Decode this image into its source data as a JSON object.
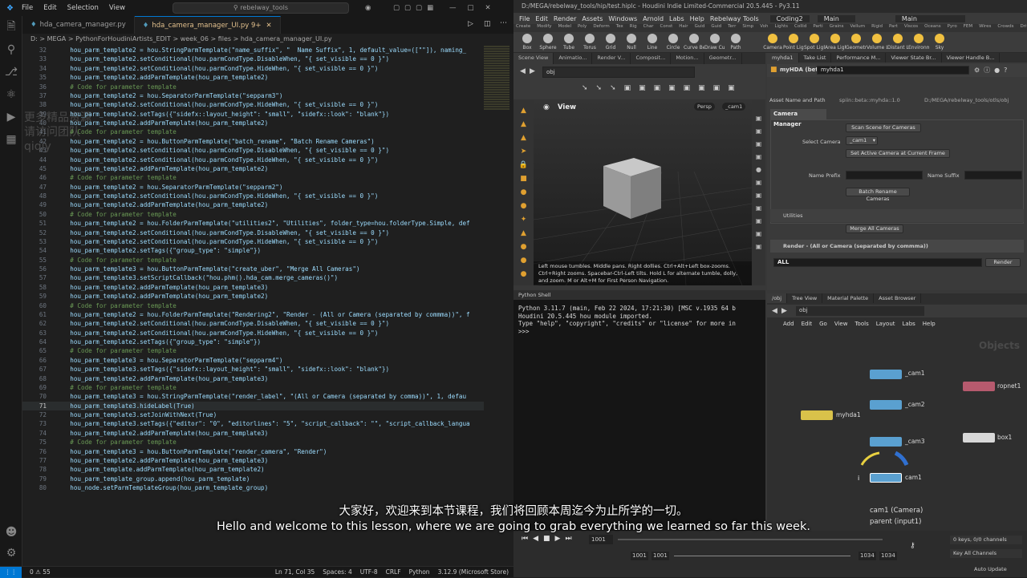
{
  "vscode": {
    "menu": [
      "File",
      "Edit",
      "Selection",
      "View"
    ],
    "search": "rebelway_tools",
    "tabs": [
      {
        "label": "hda_camera_manager.py",
        "active": false
      },
      {
        "label": "hda_camera_manager_UI.py 9+",
        "active": true
      }
    ],
    "breadcrumb": "D: > MEGA > PythonForHoudiniArtists_EDIT > week_06 > files > hda_camera_manager_UI.py",
    "code": [
      {
        "n": "32",
        "t": "    hou_parm_template2 = hou.StringParmTemplate(\"name_suffix\", \"  Name Suffix\", 1, default_value=([\"\"]), naming_"
      },
      {
        "n": "33",
        "t": "    hou_parm_template2.setConditional(hou.parmCondType.DisableWhen, \"{ set_visible == 0 }\")"
      },
      {
        "n": "34",
        "t": "    hou_parm_template2.setConditional(hou.parmCondType.HideWhen, \"{ set_visible == 0 }\")"
      },
      {
        "n": "35",
        "t": "    hou_parm_template2.addParmTemplate(hou_parm_template2)"
      },
      {
        "n": "36",
        "t": "    # Code for parameter template",
        "c": true
      },
      {
        "n": "37",
        "t": "    hou_parm_template2 = hou.SeparatorParmTemplate(\"sepparm3\")"
      },
      {
        "n": "38",
        "t": "    hou_parm_template2.setConditional(hou.parmCondType.HideWhen, \"{ set_visible == 0 }\")"
      },
      {
        "n": "39",
        "t": "    hou_parm_template2.setTags({\"sidefx::layout_height\": \"small\", \"sidefx::look\": \"blank\"})"
      },
      {
        "n": "40",
        "t": "    hou_parm_template2.addParmTemplate(hou_parm_template2)"
      },
      {
        "n": "41",
        "t": "    # Code for parameter template",
        "c": true
      },
      {
        "n": "42",
        "t": "    hou_parm_template2 = hou.ButtonParmTemplate(\"batch_rename\", \"Batch Rename Cameras\")"
      },
      {
        "n": "43",
        "t": "    hou_parm_template2.setConditional(hou.parmCondType.DisableWhen, \"{ set_visible == 0 }\")"
      },
      {
        "n": "44",
        "t": "    hou_parm_template2.setConditional(hou.parmCondType.HideWhen, \"{ set_visible == 0 }\")"
      },
      {
        "n": "45",
        "t": "    hou_parm_template2.addParmTemplate(hou_parm_template2)"
      },
      {
        "n": "46",
        "t": "    # Code for parameter template",
        "c": true
      },
      {
        "n": "47",
        "t": "    hou_parm_template2 = hou.SeparatorParmTemplate(\"sepparm2\")"
      },
      {
        "n": "48",
        "t": "    hou_parm_template2.setConditional(hou.parmCondType.HideWhen, \"{ set_visible == 0 }\")"
      },
      {
        "n": "49",
        "t": "    hou_parm_template2.addParmTemplate(hou_parm_template2)"
      },
      {
        "n": "50",
        "t": "    # Code for parameter template",
        "c": true
      },
      {
        "n": "51",
        "t": "    hou_parm_template2 = hou.FolderParmTemplate(\"utilities2\", \"Utilities\", folder_type=hou.folderType.Simple, def"
      },
      {
        "n": "52",
        "t": "    hou_parm_template2.setConditional(hou.parmCondType.DisableWhen, \"{ set_visible == 0 }\")"
      },
      {
        "n": "53",
        "t": "    hou_parm_template2.setConditional(hou.parmCondType.HideWhen, \"{ set_visible == 0 }\")"
      },
      {
        "n": "54",
        "t": "    hou_parm_template2.setTags({\"group_type\": \"simple\"})"
      },
      {
        "n": "55",
        "t": "    # Code for parameter template",
        "c": true
      },
      {
        "n": "56",
        "t": "    hou_parm_template3 = hou.ButtonParmTemplate(\"create_uber\", \"Merge All Cameras\")"
      },
      {
        "n": "57",
        "t": "    hou_parm_template3.setScriptCallback(\"hou.phm().hda_cam.merge_cameras()\")"
      },
      {
        "n": "58",
        "t": "    hou_parm_template2.addParmTemplate(hou_parm_template3)"
      },
      {
        "n": "59",
        "t": "    hou_parm_template2.addParmTemplate(hou_parm_template2)"
      },
      {
        "n": "60",
        "t": "    # Code for parameter template",
        "c": true
      },
      {
        "n": "61",
        "t": "    hou_parm_template2 = hou.FolderParmTemplate(\"Rendering2\", \"Render - (All or Camera (separated by commma))\", f"
      },
      {
        "n": "62",
        "t": "    hou_parm_template2.setConditional(hou.parmCondType.DisableWhen, \"{ set_visible == 0 }\")"
      },
      {
        "n": "63",
        "t": "    hou_parm_template2.setConditional(hou.parmCondType.HideWhen, \"{ set_visible == 0 }\")"
      },
      {
        "n": "64",
        "t": "    hou_parm_template2.setTags({\"group_type\": \"simple\"})"
      },
      {
        "n": "65",
        "t": "    # Code for parameter template",
        "c": true
      },
      {
        "n": "66",
        "t": "    hou_parm_template3 = hou.SeparatorParmTemplate(\"sepparm4\")"
      },
      {
        "n": "67",
        "t": "    hou_parm_template3.setTags({\"sidefx::layout_height\": \"small\", \"sidefx::look\": \"blank\"})"
      },
      {
        "n": "68",
        "t": "    hou_parm_template2.addParmTemplate(hou_parm_template3)"
      },
      {
        "n": "69",
        "t": "    # Code for parameter template",
        "c": true
      },
      {
        "n": "70",
        "t": "    hou_parm_template3 = hou.StringParmTemplate(\"render_label\", \"(All or Camera (separated by comma))\", 1, defau"
      },
      {
        "n": "71",
        "t": "    hou_parm_template3.hideLabel(True)",
        "cur": true
      },
      {
        "n": "72",
        "t": "    hou_parm_template3.setJoinWithNext(True)"
      },
      {
        "n": "73",
        "t": "    hou_parm_template3.setTags({\"editor\": \"0\", \"editorlines\": \"5\", \"script_callback\": \"\", \"script_callback_langua"
      },
      {
        "n": "74",
        "t": "    hou_parm_template2.addParmTemplate(hou_parm_template3)"
      },
      {
        "n": "75",
        "t": "    # Code for parameter template",
        "c": true
      },
      {
        "n": "76",
        "t": "    hou_parm_template3 = hou.ButtonParmTemplate(\"render_camera\", \"Render\")"
      },
      {
        "n": "77",
        "t": "    hou_parm_template2.addParmTemplate(hou_parm_template3)"
      },
      {
        "n": "78",
        "t": "    hou_parm_template.addParmTemplate(hou_parm_template2)"
      },
      {
        "n": "79",
        "t": "    hou_parm_template_group.append(hou_parm_template)"
      },
      {
        "n": "80",
        "t": "    hou_node.setParmTemplateGroup(hou_parm_template_group)"
      }
    ],
    "status": {
      "errors": "0 ⚠ 55",
      "position": "Ln 71, Col 35",
      "spaces": "Spaces: 4",
      "encoding": "UTF-8",
      "eol": "CRLF",
      "language": "Python",
      "interpreter": "3.12.9 (Microsoft Store)"
    },
    "watermark": "更多精品资源请访问团队 qiqiy"
  },
  "houdini": {
    "title": "D:/MEGA/rebelway_tools/hip/test.hiplc - Houdini Indie Limited-Commercial 20.5.445 - Py3.11",
    "menu": [
      "File",
      "Edit",
      "Render",
      "Assets",
      "Windows",
      "Arnold",
      "Labs",
      "Help",
      "Rebelway Tools",
      "Coding2",
      "Main",
      "Main"
    ],
    "shelf_tabs": [
      "Create",
      "Modify",
      "Model",
      "Poly",
      "Deform",
      "Tex",
      "Rig",
      "Char",
      "Const",
      "Hair",
      "Guid",
      "Guid",
      "Terr",
      "Simp",
      "Voh",
      "Lights",
      "Collid",
      "Parti",
      "Grains",
      "Vellum",
      "Rigid",
      "Part",
      "Viscos",
      "Oceans",
      "Pyro",
      "FEM",
      "Wires",
      "Crowds",
      "Drive"
    ],
    "shelf_tools": [
      "Box",
      "Sphere",
      "Tube",
      "Torus",
      "Grid",
      "Null",
      "Line",
      "Circle",
      "Curve Bezier",
      "Draw Curve",
      "Path",
      "Camera",
      "Point Light",
      "Spot Light",
      "Area Light",
      "Geometry Light",
      "Volume Light",
      "Distant Light",
      "Environment Light",
      "Sky"
    ],
    "viewport": {
      "tabs": [
        "Scene View",
        "Animatio...",
        "Render V...",
        "Composit...",
        "Motion...",
        "Geometr..."
      ],
      "path": "obj",
      "title": "View",
      "persp": "Persp",
      "cam": "_cam1",
      "help": "Left mouse tumbles. Middle pans. Right dollies. Ctrl+Alt+Left box-zooms. Ctrl+Right zooms. Spacebar-Ctrl-Left tilts. Hold L for alternate tumble, dolly, and zoom. M or Alt+M for First Person Navigation.",
      "edition": "Indie Edition"
    },
    "shell": {
      "tab": "Python Shell",
      "lines": [
        "Python 3.11.7 (main, Feb 22 2024, 17:21:30) [MSC v.1935 64 b",
        "Houdini 20.5.445 hou module imported.",
        "Type \"help\", \"copyright\", \"credits\" or \"license\" for more in",
        ">>>"
      ]
    },
    "params": {
      "tabs": [
        "myhda1",
        "Take List",
        "Performance M...",
        "Viewer State Br...",
        "Viewer Handle B..."
      ],
      "node_type": "myHDA (beta)",
      "node_name": "myhda1",
      "asset_label": "Asset Name and Path",
      "asset_name": "spiin::beta::myhda::1.0",
      "asset_path": "D:/MEGA/rebelway_tools/otls/obj",
      "section": "Camera Manager",
      "scan_btn": "Scan Scene for Cameras",
      "select_label": "Select Camera",
      "select_value": "_cam1",
      "set_active_btn": "Set Active Camera at Current Frame",
      "prefix_label": "Name Prefix",
      "suffix_label": "Name Suffix",
      "batch_btn": "Batch Rename Cameras",
      "utilities": "Utilities",
      "merge_btn": "Merge All Cameras",
      "render_folder": "Render - (All or Camera (separated by commma))",
      "render_value": "ALL",
      "render_btn": "Render"
    },
    "network": {
      "tabs": [
        "/obj",
        "Tree View",
        "Material Palette",
        "Asset Browser"
      ],
      "path": "obj",
      "menu": [
        "Add",
        "Edit",
        "Go",
        "View",
        "Tools",
        "Layout",
        "Labs",
        "Help"
      ],
      "context": "Objects",
      "nodes": [
        "_cam1",
        "_cam2",
        "myhda1",
        "_cam3",
        "cam1",
        "ropnet1",
        "box1"
      ],
      "selected_info": [
        "cam1 (Camera)",
        "parent (input1)"
      ]
    },
    "timeline": {
      "frame": "1001",
      "start": "1001",
      "start2": "1001",
      "end": "1034",
      "end2": "1034",
      "keys": "0 keys, 0/0 channels",
      "key_all": "Key All Channels",
      "auto_update": "Auto Update"
    }
  },
  "subtitles": {
    "cn": "大家好，欢迎来到本节课程，我们将回顾本周迄今为止所学的一切。",
    "en": "Hello and welcome to this lesson, where we are going to grab everything we learned so far this week."
  }
}
